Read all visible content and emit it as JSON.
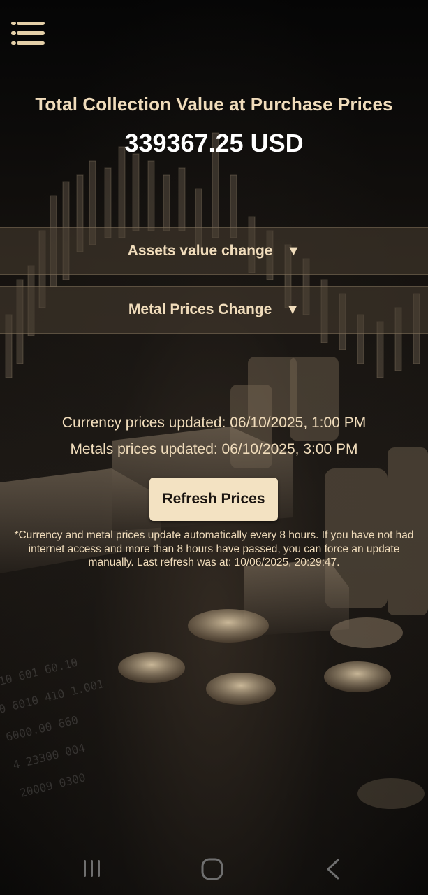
{
  "header": {
    "menu_icon": "hamburger-menu-icon"
  },
  "summary": {
    "title": "Total Collection Value at Purchase Prices",
    "total_value": "339367.25 USD"
  },
  "sections": [
    {
      "label": "Assets value change",
      "arrow": "▼"
    },
    {
      "label": "Metal Prices Change",
      "arrow": "▼"
    }
  ],
  "updates": {
    "currency": "Currency prices updated: 06/10/2025, 1:00 PM",
    "metals": "Metals prices updated: 06/10/2025, 3:00 PM",
    "refresh_label": "Refresh Prices",
    "note": "*Currency and metal prices update automatically every 8 hours. If you have not had internet access and more than 8 hours have passed, you can force an update manually. Last refresh was at: 10/06/2025, 20:29:47."
  },
  "navbar": {
    "recent_icon": "recent-apps-icon",
    "home_icon": "home-icon",
    "back_icon": "back-icon"
  },
  "colors": {
    "accent": "#f0dcbb",
    "button_bg": "#f3e2c2",
    "background": "#000000"
  }
}
